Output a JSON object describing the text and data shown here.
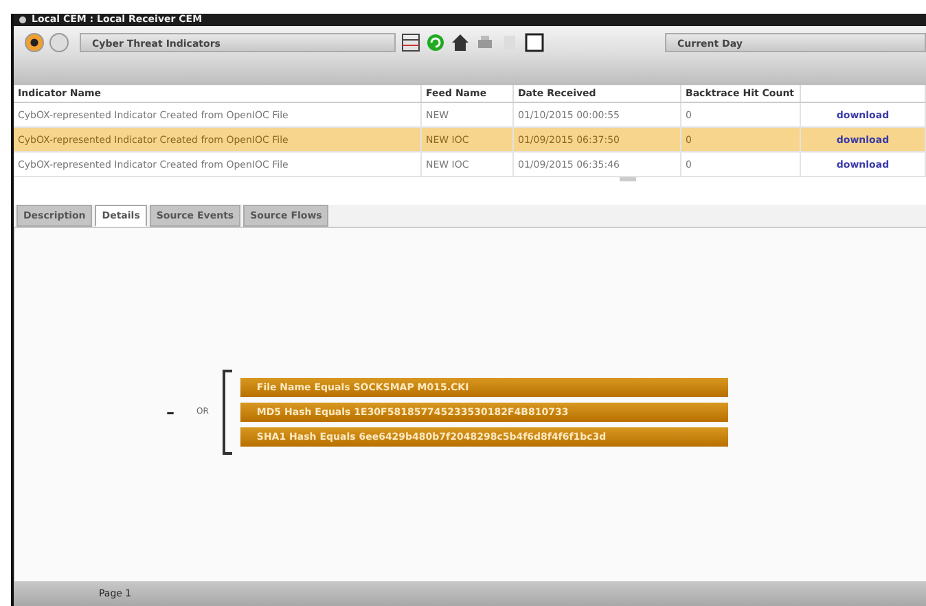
{
  "window": {
    "title": "Local CEM : Local Receiver CEM"
  },
  "toolbar": {
    "view_select": "Cyber Threat Indicators",
    "range_select": "Current Day"
  },
  "table": {
    "columns": [
      "Indicator Name",
      "Feed Name",
      "Date Received",
      "Backtrace Hit Count"
    ],
    "rows": [
      {
        "cells": [
          "CybOX-represented Indicator Created from OpenIOC File",
          "NEW",
          "01/10/2015 00:00:55",
          "0"
        ],
        "action": "download",
        "selected": false
      },
      {
        "cells": [
          "CybOX-represented Indicator Created from OpenIOC File",
          "NEW IOC",
          "01/09/2015 06:37:50",
          "0"
        ],
        "action": "download",
        "selected": true
      },
      {
        "cells": [
          "CybOX-represented Indicator Created from OpenIOC File",
          "NEW IOC",
          "01/09/2015 06:35:46",
          "0"
        ],
        "action": "download",
        "selected": false
      }
    ]
  },
  "tabs": [
    {
      "label": "Description",
      "selected": false
    },
    {
      "label": "Details",
      "selected": true
    },
    {
      "label": "Source Events",
      "selected": false
    },
    {
      "label": "Source Flows",
      "selected": false
    }
  ],
  "details": {
    "collapse": "–",
    "operator": "OR",
    "conditions": [
      "File Name Equals SOCKSMAP M015.CKI",
      "MD5 Hash Equals 1E30F581857745233530182F4B810733",
      "SHA1 Hash Equals 6ee6429b480b7f2048298c5b4f6d8f4f6f1bc3d"
    ]
  },
  "status_bar": {
    "page": "Page 1"
  }
}
